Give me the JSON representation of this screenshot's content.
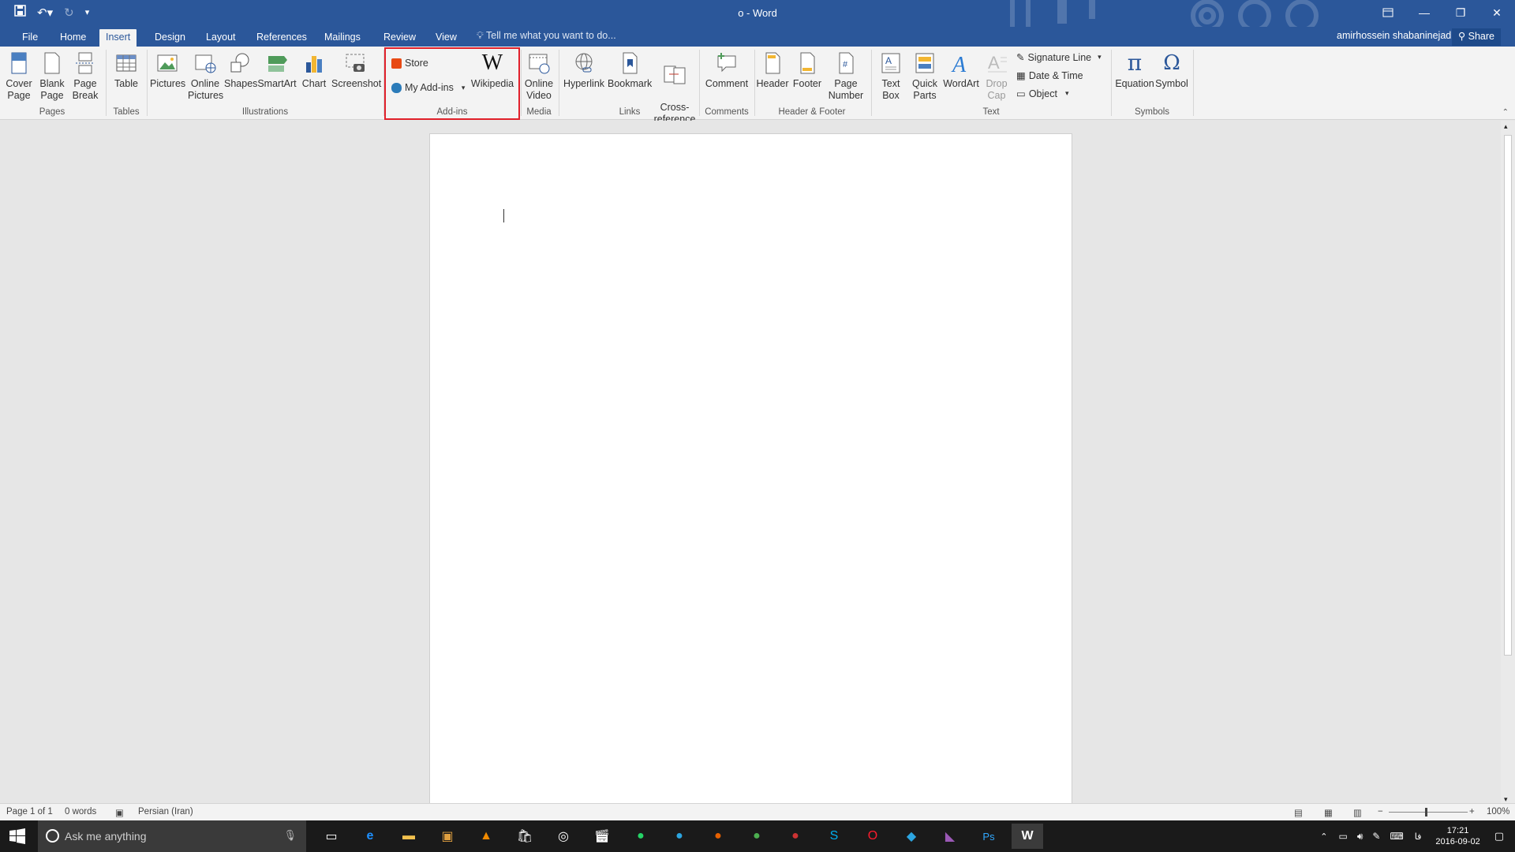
{
  "window": {
    "title": "o - Word",
    "qat": {
      "save_icon": "save-icon",
      "undo_icon": "undo-icon",
      "redo_icon": "redo-icon",
      "customize_icon": "customize-icon"
    },
    "controls": {
      "ribbon_options": "ribbon-display-icon",
      "minimize": "minimize-icon",
      "restore": "restore-icon",
      "close": "close-icon"
    }
  },
  "tabs": [
    {
      "label": "File"
    },
    {
      "label": "Home"
    },
    {
      "label": "Insert",
      "active": true
    },
    {
      "label": "Design"
    },
    {
      "label": "Layout"
    },
    {
      "label": "References"
    },
    {
      "label": "Mailings"
    },
    {
      "label": "Review"
    },
    {
      "label": "View"
    }
  ],
  "tell_me": "Tell me what you want to do...",
  "user_name": "amirhossein shabaninejad",
  "share_label": "Share",
  "ribbon": {
    "pages": {
      "label": "Pages",
      "cover": "Cover Page",
      "blank": "Blank Page",
      "break": "Page Break"
    },
    "tables": {
      "label": "Tables",
      "table": "Table"
    },
    "illustrations": {
      "label": "Illustrations",
      "pictures": "Pictures",
      "online_pictures": "Online Pictures",
      "shapes": "Shapes",
      "smartart": "SmartArt",
      "chart": "Chart",
      "screenshot": "Screenshot"
    },
    "addins": {
      "label": "Add-ins",
      "store": "Store",
      "my_addins": "My Add-ins",
      "wikipedia": "Wikipedia",
      "wikipedia_glyph": "W"
    },
    "media": {
      "label": "Media",
      "online_video": "Online Video"
    },
    "links": {
      "label": "Links",
      "hyperlink": "Hyperlink",
      "bookmark": "Bookmark",
      "crossref": "Cross-reference"
    },
    "comments": {
      "label": "Comments",
      "comment": "Comment"
    },
    "header_footer": {
      "label": "Header & Footer",
      "header": "Header",
      "footer": "Footer",
      "page_number": "Page Number"
    },
    "text": {
      "label": "Text",
      "text_box": "Text Box",
      "quick_parts": "Quick Parts",
      "wordart": "WordArt",
      "drop_cap": "Drop Cap",
      "signature": "Signature Line",
      "datetime": "Date & Time",
      "object": "Object"
    },
    "symbols": {
      "label": "Symbols",
      "equation": "Equation",
      "symbol": "Symbol",
      "pi_glyph": "π",
      "omega_glyph": "Ω"
    }
  },
  "status": {
    "page": "Page 1 of 1",
    "words": "0 words",
    "language": "Persian (Iran)",
    "zoom": "100%"
  },
  "taskbar": {
    "search_placeholder": "Ask me anything",
    "time": "17:21",
    "date": "2016-09-02",
    "lang": "فا"
  }
}
